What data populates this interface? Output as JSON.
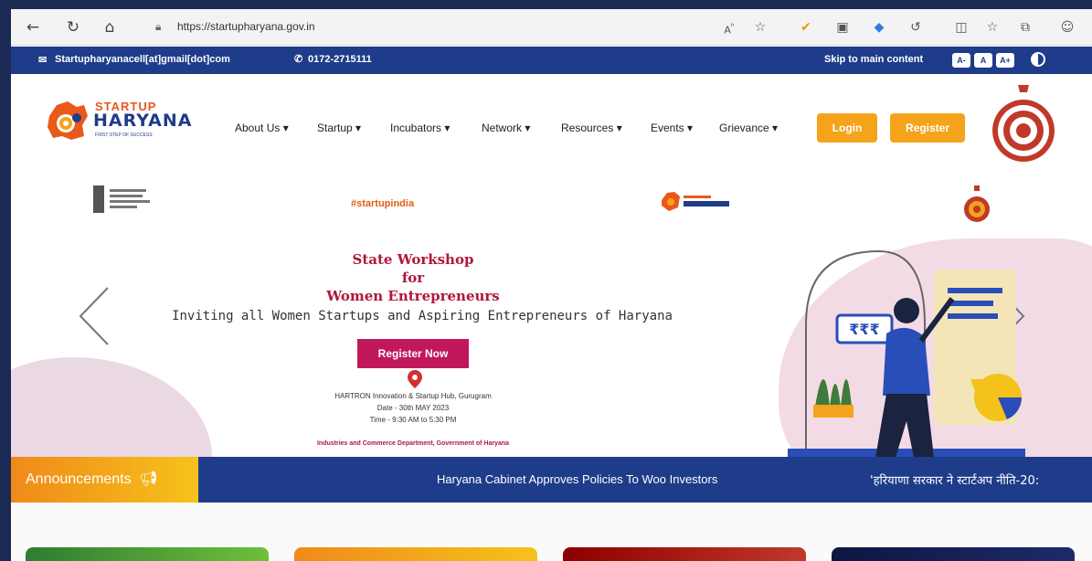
{
  "browser": {
    "url": "https://startupharyana.gov.in"
  },
  "topbar": {
    "email": "Startupharyanacell[at]gmail[dot]com",
    "phone": "0172-2715111",
    "skip_link": "Skip to main content",
    "font_small": "A-",
    "font_normal": "A",
    "font_large": "A+"
  },
  "logo": {
    "line1": "STARTUP",
    "line2": "HARYANA",
    "tagline": "FIRST STEP OF SUCCESS"
  },
  "nav": {
    "items": [
      "About Us ▾",
      "Startup ▾",
      "Incubators ▾",
      "Network ▾",
      "Resources ▾",
      "Events ▾",
      "Grievance ▾"
    ]
  },
  "auth": {
    "login": "Login",
    "register": "Register"
  },
  "banner": {
    "sponsor_startupindia": "#startupindia",
    "headline_1": "State Workshop",
    "headline_2": "for",
    "headline_3": "Women Entrepreneurs",
    "subline": "Inviting all Women Startups and Aspiring Entrepreneurs of Haryana",
    "cta": "Register Now",
    "venue": "HARTRON Innovation & Startup Hub, Gurugram",
    "date": "Date - 30th MAY 2023",
    "time": "Time - 9:30 AM to 5:30 PM",
    "dept": "Industries and Commerce Department,  Government of Haryana",
    "currency_sign": "₹₹₹"
  },
  "announcements": {
    "label": "Announcements",
    "item1": "Haryana Cabinet Approves Policies To Woo Investors",
    "item2": "'हरियाणा सरकार ने स्टार्टअप नीति-20:"
  },
  "colors": {
    "brand_blue": "#1f3c8a",
    "brand_orange": "#f4a31a",
    "accent_crimson": "#b0173b",
    "cta_pink": "#c0185a"
  }
}
